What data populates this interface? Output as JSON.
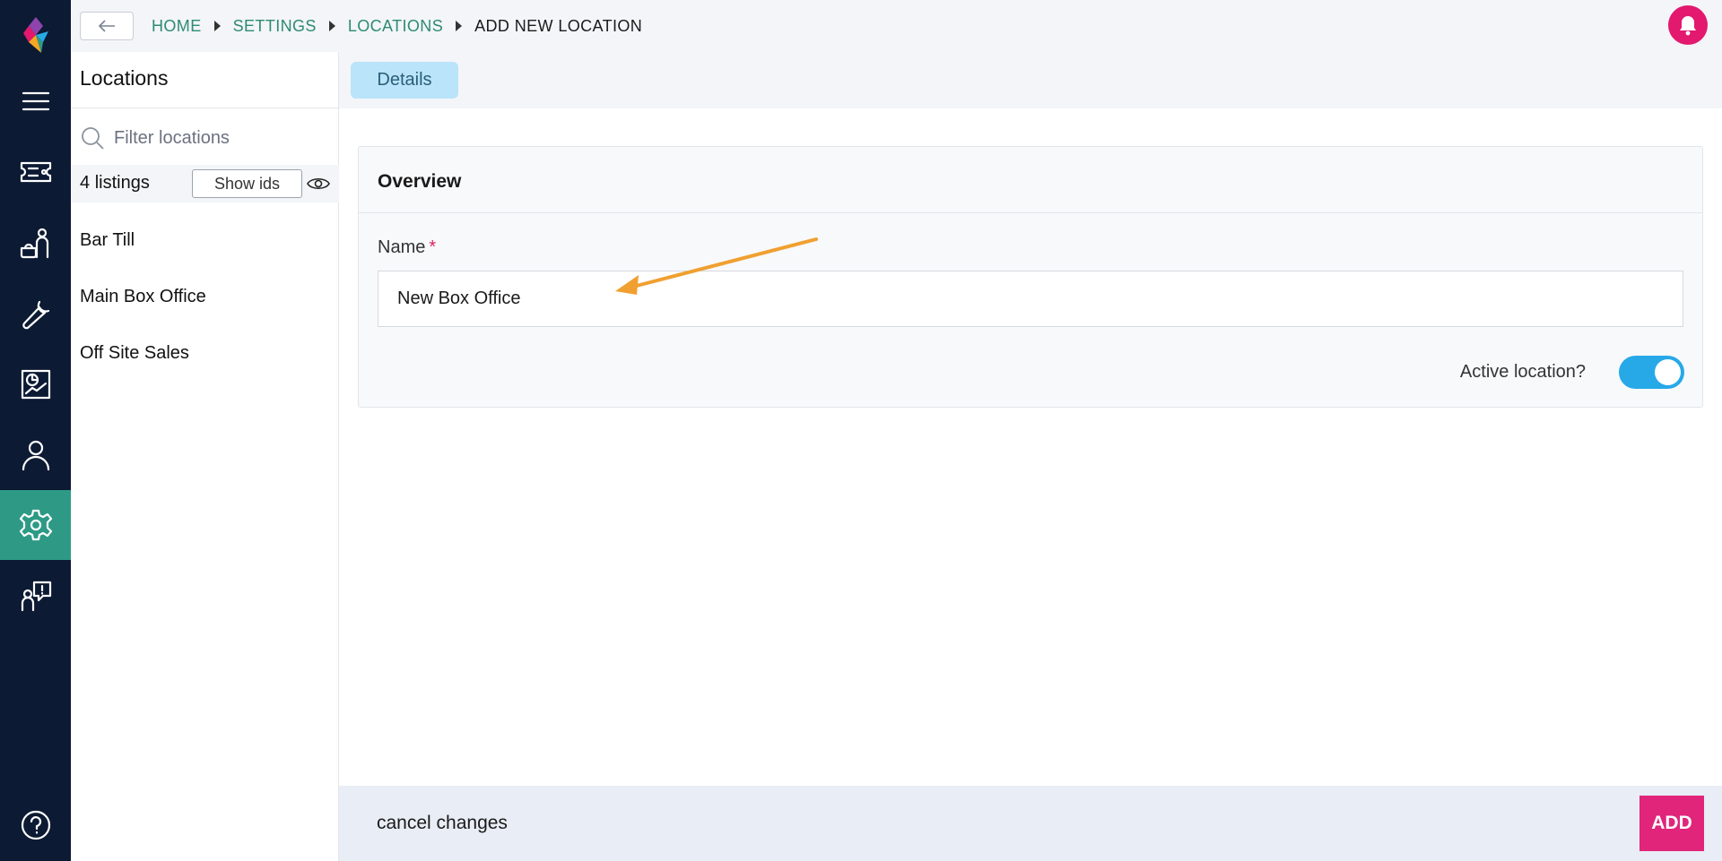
{
  "rail": {
    "items": [
      {
        "name": "menu"
      },
      {
        "name": "tickets"
      },
      {
        "name": "attendees"
      },
      {
        "name": "tools"
      },
      {
        "name": "reports"
      },
      {
        "name": "customers"
      },
      {
        "name": "settings",
        "active": true
      },
      {
        "name": "support"
      },
      {
        "name": "help"
      }
    ]
  },
  "breadcrumb": {
    "home": "HOME",
    "settings": "SETTINGS",
    "locations": "LOCATIONS",
    "current": "ADD NEW LOCATION"
  },
  "sidebar": {
    "title": "Locations",
    "filter_placeholder": "Filter locations",
    "listing_count": "4",
    "listing_label": "listings",
    "show_ids_label": "Show ids",
    "items": [
      {
        "label": "Bar Till"
      },
      {
        "label": "Main Box Office"
      },
      {
        "label": "Off Site Sales"
      }
    ]
  },
  "tabs": [
    {
      "label": "Details"
    }
  ],
  "overview": {
    "title": "Overview",
    "name_label": "Name",
    "required_mark": "*",
    "name_value": "New Box Office",
    "active_label": "Active location?",
    "active_on": true
  },
  "footer": {
    "cancel_label": "cancel changes",
    "add_label": "ADD"
  },
  "colors": {
    "rail_bg": "#0c1a33",
    "rail_active": "#2e9a86",
    "accent_link": "#2e8a74",
    "toggle_on": "#27a9e8",
    "add_button": "#e0257a",
    "bell": "#e3186f",
    "annotation_arrow": "#f0a030"
  }
}
